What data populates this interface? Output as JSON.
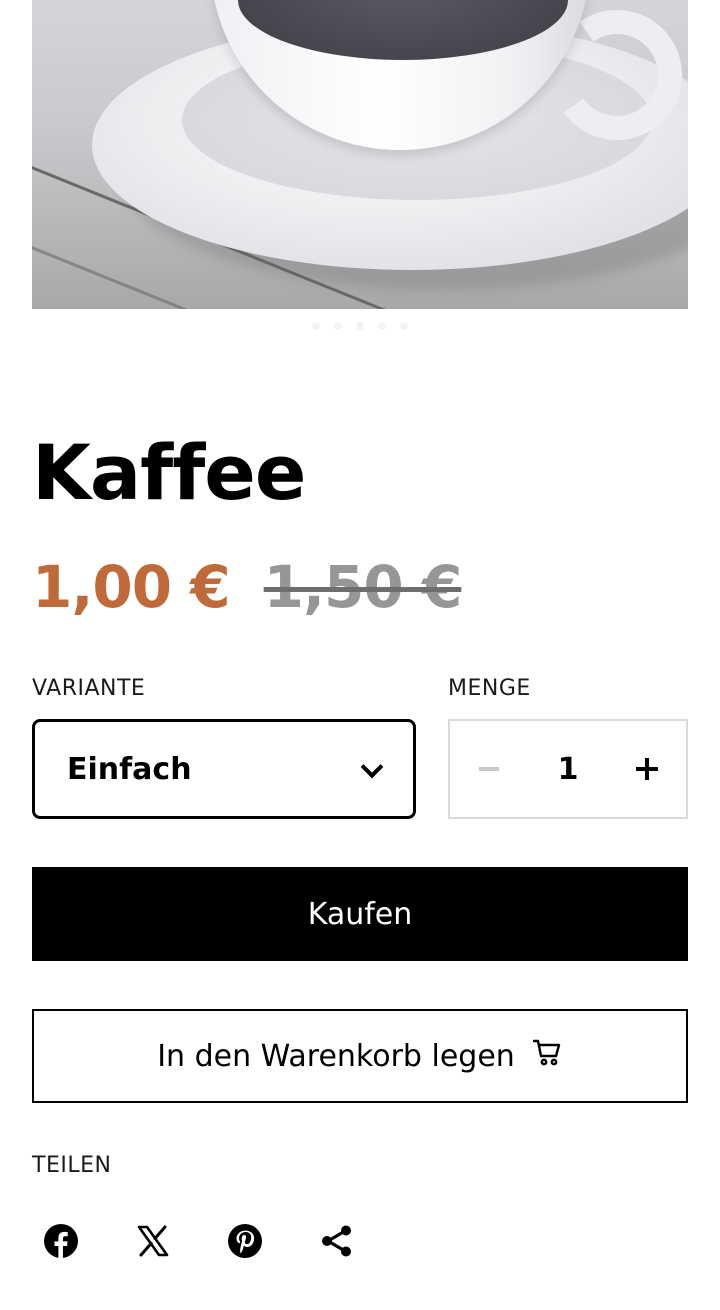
{
  "product": {
    "title": "Kaffee",
    "price": "1,00 €",
    "compare_price": "1,50 €",
    "accent_color": "#bf6a3a"
  },
  "variant": {
    "label": "VARIANTE",
    "selected": "Einfach"
  },
  "quantity": {
    "label": "MENGE",
    "value": "1"
  },
  "actions": {
    "buy_label": "Kaufen",
    "cart_label": "In den Warenkorb legen"
  },
  "share": {
    "label": "TEILEN",
    "icons": [
      "facebook-icon",
      "x-icon",
      "pinterest-icon",
      "share-icon"
    ]
  },
  "gallery": {
    "image": "coffee-cup-photo",
    "dots": 5
  }
}
